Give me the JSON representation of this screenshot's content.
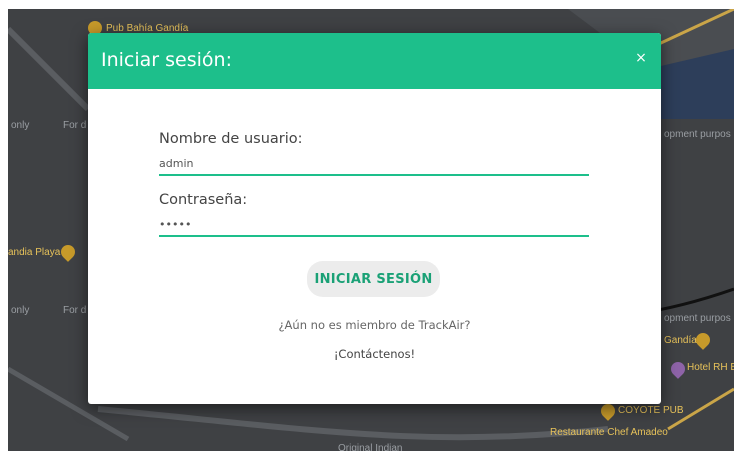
{
  "background_map": {
    "labels": {
      "pub": "Pub Bahía Gandía",
      "only_left_1": "only",
      "for_left_1": "For d",
      "only_left_2": "only",
      "for_left_2": "For d",
      "playa": "andia Playa",
      "dev_right_1": "opment purpos",
      "dev_right_2": "opment purpos",
      "gandia_right": "Gandía",
      "hotel": "Hotel RH Bayr",
      "coyote": "COYOTE PUB",
      "restaurante": "Restaurante Chef Amadeo",
      "original": "Original Indian"
    },
    "colors": {
      "land": "#3f4144",
      "sea": "#2d3e5a",
      "road": "#caa548"
    }
  },
  "login_modal": {
    "title": "Iniciar sesión:",
    "close_label": "×",
    "username": {
      "label": "Nombre de usuario:",
      "value": "admin"
    },
    "password": {
      "label": "Contraseña:",
      "value": "•••••"
    },
    "submit_label": "INICIAR SESIÓN",
    "not_member_text": "¿Aún no es miembro de TrackAir?",
    "contact_label": "¡Contáctenos!",
    "colors": {
      "accent": "#1dbf8b",
      "button_bg": "#ececec",
      "button_text": "#1aa176"
    }
  }
}
